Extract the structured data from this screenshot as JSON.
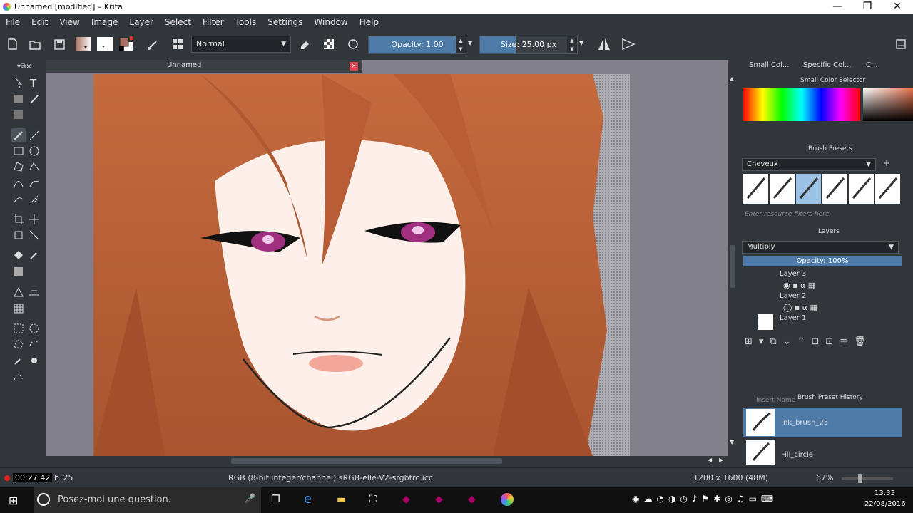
{
  "window": {
    "title": "Unnamed [modified] – Krita",
    "minimize": "—",
    "maximize": "❐",
    "close": "✕"
  },
  "menu": [
    "File",
    "Edit",
    "View",
    "Image",
    "Layer",
    "Select",
    "Filter",
    "Tools",
    "Settings",
    "Window",
    "Help"
  ],
  "toolbar": {
    "blend_mode": "Normal",
    "opacity_label": "Opacity:  1.00",
    "opacity_value": 1.0,
    "size_label": "Size:  25.00 px",
    "size_value_fraction": 0.25,
    "fg_color": "#a87060",
    "bg_color": "#ffffff"
  },
  "document": {
    "tab_title": "Unnamed",
    "close": "×"
  },
  "dockers": {
    "tabs": [
      "Small Col...",
      "Specific Col...",
      "C..."
    ],
    "small_color_title": "Small Color Selector",
    "brush_presets_title": "Brush Presets",
    "preset_tag": "Cheveux",
    "filter_placeholder": "Enter resource filters here",
    "layers_title": "Layers",
    "layer_blend": "Multiply",
    "layer_opacity": "Opacity:  100%",
    "layers": [
      {
        "name": "Layer 3"
      },
      {
        "name": "Layer 2"
      },
      {
        "name": "Layer 1"
      }
    ],
    "history_title": "Brush Preset History",
    "history_filter": "Insert Name",
    "history": [
      {
        "name": "Ink_brush_25",
        "selected": true
      },
      {
        "name": "Fill_circle",
        "selected": false
      }
    ]
  },
  "status": {
    "recording": "00:27:42",
    "brush_name": "h_25",
    "color_space": "RGB (8-bit integer/channel)  sRGB-elle-V2-srgbtrc.icc",
    "dimensions": "1200 x 1600 (48M)",
    "zoom": "67%",
    "zoom_fraction": 0.67
  },
  "taskbar": {
    "search_placeholder": "Posez-moi une question.",
    "time": "13:33",
    "date": "22/08/2016"
  },
  "colors": {
    "accent": "#4e7aa8",
    "panel": "#31363b",
    "canvas_bg": "#82808a",
    "hair": "#b45a32",
    "skin": "#fdf0ea"
  }
}
